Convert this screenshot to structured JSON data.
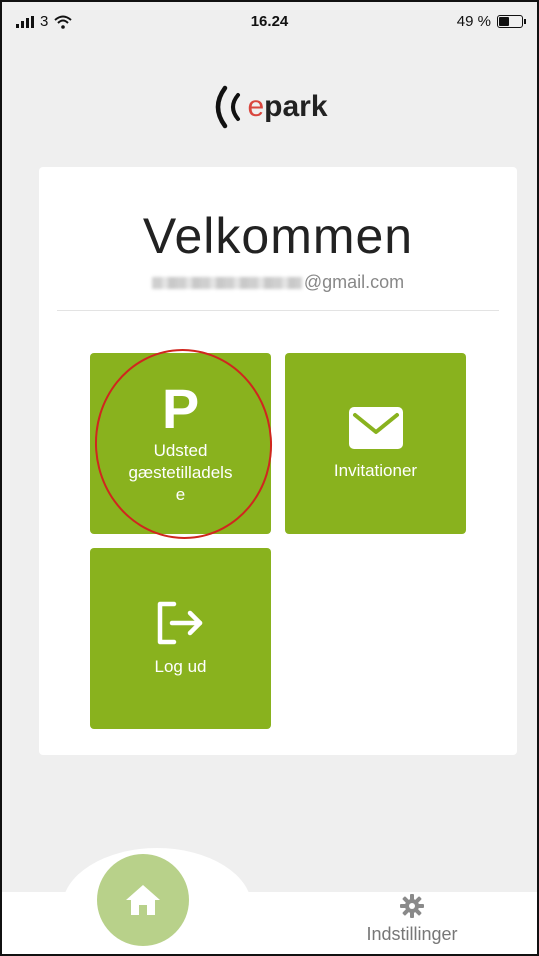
{
  "status_bar": {
    "carrier": "3",
    "time": "16.24",
    "battery_text": "49 %",
    "battery_level": 0.49
  },
  "logo": {
    "e": "e",
    "text": "park"
  },
  "welcome": {
    "title": "Velkommen",
    "email_visible": "@gmail.com"
  },
  "tiles": {
    "issue_permit": {
      "icon_letter": "P",
      "label_line1": "Udsted",
      "label_line2": "gæstetilladels",
      "label_line3": "e"
    },
    "invitations": {
      "label": "Invitationer"
    },
    "logout": {
      "label": "Log ud"
    }
  },
  "bottom_nav": {
    "settings_label": "Indstillinger"
  },
  "colors": {
    "tile_green": "#89b21e",
    "home_green": "#b8d18a",
    "annotation_red": "#d0261e",
    "logo_e_red": "#d9463e"
  },
  "icons": {
    "home": "home-icon",
    "settings": "gear-icon",
    "invitations": "envelope-icon",
    "logout": "logout-icon"
  }
}
